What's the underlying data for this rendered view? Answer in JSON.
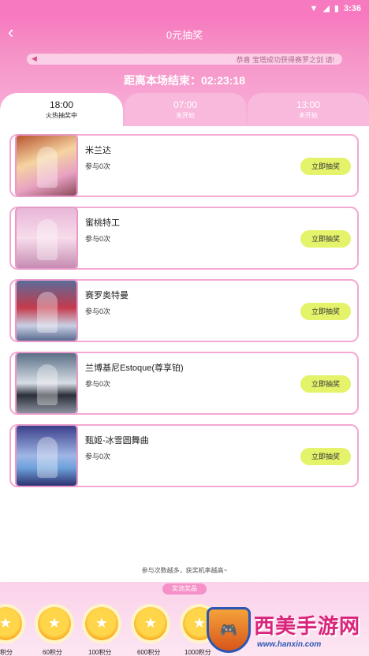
{
  "status_bar": {
    "time": "3:36"
  },
  "header": {
    "title": "0元抽奖",
    "back_icon": "chevron-left-icon"
  },
  "marquee": {
    "text": "恭喜 宝塔成功获得赛罗之剑 请!"
  },
  "countdown": {
    "label": "距离本场结束：02:23:18"
  },
  "tabs": [
    {
      "time": "18:00",
      "status": "火热抽奖中",
      "active": true
    },
    {
      "time": "07:00",
      "status": "未开始",
      "active": false
    },
    {
      "time": "13:00",
      "status": "未开始",
      "active": false
    }
  ],
  "items": [
    {
      "name": "米兰达",
      "participation": "参与0次",
      "button": "立即抽奖"
    },
    {
      "name": "蜜桃特工",
      "participation": "参与0次",
      "button": "立即抽奖"
    },
    {
      "name": "赛罗奥特曼",
      "participation": "参与0次",
      "button": "立即抽奖"
    },
    {
      "name": "兰博基尼Estoque(尊享铂)",
      "participation": "参与0次",
      "button": "立即抽奖"
    },
    {
      "name": "甄姬-冰雪圆舞曲",
      "participation": "参与0次",
      "button": "立即抽奖"
    }
  ],
  "hint": "参与次数越多，获奖机率越高~",
  "rewards": {
    "badge": "奖池奖品",
    "coins": [
      "积分",
      "60积分",
      "100积分",
      "600积分",
      "1000积分"
    ]
  },
  "watermark": {
    "brand": "西美手游网",
    "url": "www.hanxin.com"
  },
  "colors": {
    "accent": "#f77ac0",
    "button": "#e4f36a",
    "border": "#f4a8d3"
  }
}
